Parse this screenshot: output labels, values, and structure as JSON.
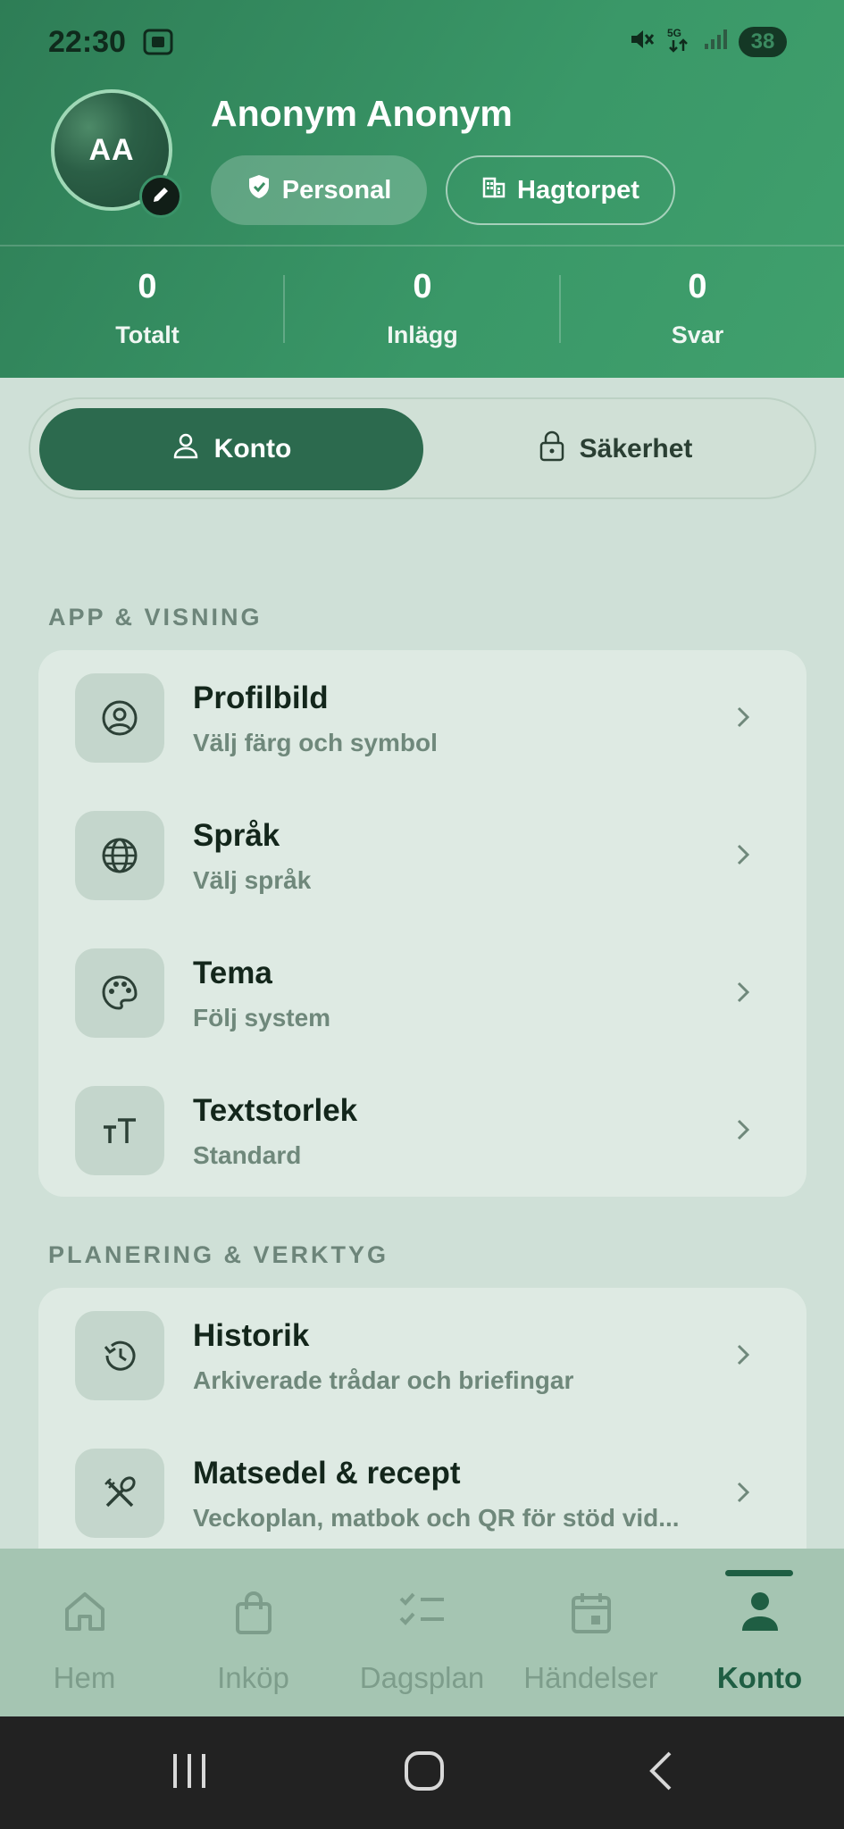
{
  "status": {
    "time": "22:30",
    "battery": "38"
  },
  "profile": {
    "initials": "AA",
    "name": "Anonym Anonym",
    "role_chip": "Personal",
    "org_chip": "Hagtorpet"
  },
  "stats": [
    {
      "value": "0",
      "label": "Totalt"
    },
    {
      "value": "0",
      "label": "Inlägg"
    },
    {
      "value": "0",
      "label": "Svar"
    }
  ],
  "segment": {
    "active": "Konto",
    "inactive": "Säkerhet"
  },
  "sections": {
    "app": {
      "title": "APP & VISNING",
      "items": [
        {
          "title": "Profilbild",
          "subtitle": "Välj färg och symbol",
          "icon": "account-circle-icon"
        },
        {
          "title": "Språk",
          "subtitle": "Välj språk",
          "icon": "globe-icon"
        },
        {
          "title": "Tema",
          "subtitle": "Följ system",
          "icon": "palette-icon"
        },
        {
          "title": "Textstorlek",
          "subtitle": "Standard",
          "icon": "text-size-icon"
        }
      ]
    },
    "planning": {
      "title": "PLANERING & VERKTYG",
      "items": [
        {
          "title": "Historik",
          "subtitle": "Arkiverade trådar och briefingar",
          "icon": "history-icon"
        },
        {
          "title": "Matsedel & recept",
          "subtitle": "Veckoplan, matbok och QR för stöd vid...",
          "icon": "utensils-icon"
        }
      ]
    }
  },
  "tabs": [
    {
      "label": "Hem",
      "icon": "home-icon"
    },
    {
      "label": "Inköp",
      "icon": "shopping-bag-icon"
    },
    {
      "label": "Dagsplan",
      "icon": "checklist-icon"
    },
    {
      "label": "Händelser",
      "icon": "calendar-icon"
    },
    {
      "label": "Konto",
      "icon": "person-icon",
      "active": true
    }
  ]
}
